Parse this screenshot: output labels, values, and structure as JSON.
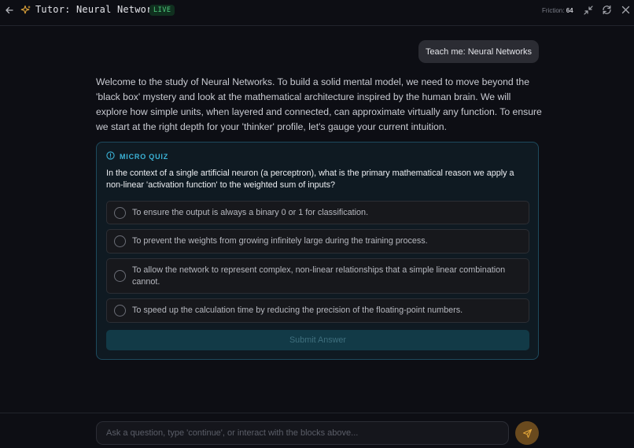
{
  "header": {
    "title": "Tutor: Neural Networks",
    "badge": "LIVE",
    "friction_label": "Friction:",
    "friction_value": "64",
    "icons": [
      "back-arrow-icon",
      "sparkle-icon",
      "minimize-icon",
      "refresh-icon",
      "close-icon"
    ]
  },
  "user_message": "Teach me: Neural Networks",
  "assistant_intro": "Welcome to the study of Neural Networks. To build a solid mental model, we need to move beyond the 'black box' mystery and look at the mathematical architecture inspired by the human brain. We will explore how simple units, when layered and connected, can approximate virtually any function. To ensure we start at the right depth for your 'thinker' profile, let's gauge your current intuition.",
  "quiz": {
    "label": "MICRO QUIZ",
    "question": "In the context of a single artificial neuron (a perceptron), what is the primary mathematical reason we apply a non-linear 'activation function' to the weighted sum of inputs?",
    "options": [
      "To ensure the output is always a binary 0 or 1 for classification.",
      "To prevent the weights from growing infinitely large during the training process.",
      "To allow the network to represent complex, non-linear relationships that a simple linear combination cannot.",
      "To speed up the calculation time by reducing the precision of the floating-point numbers."
    ],
    "submit_label": "Submit Answer"
  },
  "footer": {
    "input_placeholder": "Ask a question, type 'continue', or interact with the blocks above..."
  },
  "colors": {
    "background": "#0d0e14",
    "accent_cyan": "#3bb3d7",
    "live_green": "#4fce7e",
    "title_icon_amber": "#e0a53a",
    "send_button": "#6a4a1e"
  }
}
